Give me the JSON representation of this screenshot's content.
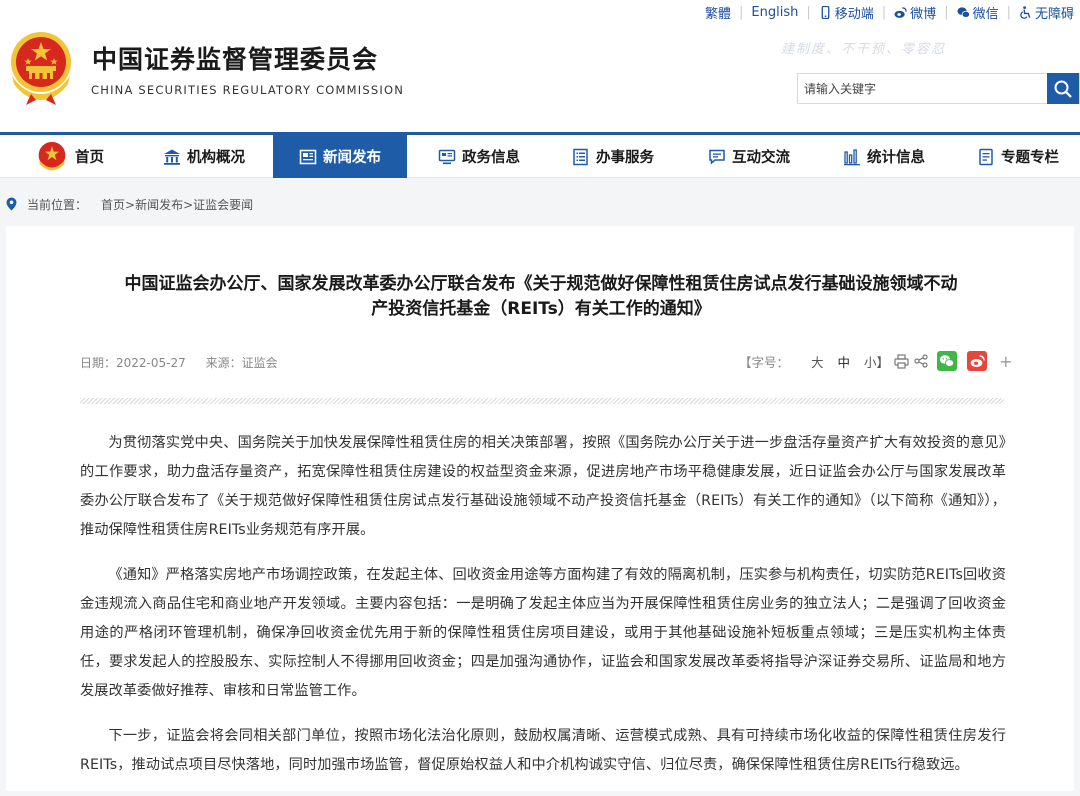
{
  "header": {
    "title_cn": "中国证券监督管理委员会",
    "title_en": "CHINA SECURITIES REGULATORY COMMISSION",
    "slogan": "建制度、不干预、零容忍",
    "top_links": {
      "traditional": "繁體",
      "english": "English",
      "mobile": "移动端",
      "weibo": "微博",
      "wechat": "微信",
      "accessibility": "无障碍"
    },
    "search_placeholder": "请输入关键字"
  },
  "nav": {
    "items": [
      {
        "label": "首页",
        "icon": "emblem-icon"
      },
      {
        "label": "机构概况",
        "icon": "building-icon"
      },
      {
        "label": "新闻发布",
        "icon": "newspaper-icon"
      },
      {
        "label": "政务信息",
        "icon": "monitor-icon"
      },
      {
        "label": "办事服务",
        "icon": "list-icon"
      },
      {
        "label": "互动交流",
        "icon": "chat-icon"
      },
      {
        "label": "统计信息",
        "icon": "bar-chart-icon"
      },
      {
        "label": "专题专栏",
        "icon": "document-icon"
      }
    ],
    "active": "新闻发布"
  },
  "breadcrumb": {
    "prefix": "当前位置：",
    "path": "首页>新闻发布>证监会要闻"
  },
  "article": {
    "title_line1": "中国证监会办公厅、国家发展改革委办公厅联合发布《关于规范做好保障性租赁住房试点发行基础设施领域不动",
    "title_line2": "产投资信托基金（REITs）有关工作的通知》",
    "date": "日期：2022-05-27",
    "source": "来源：证监会",
    "font_size_label": "【字号：",
    "font_large": "大",
    "font_medium": "中",
    "font_small": "小】",
    "plus": "+",
    "paragraphs": [
      "为贯彻落实党中央、国务院关于加快发展保障性租赁住房的相关决策部署，按照《国务院办公厅关于进一步盘活存量资产扩大有效投资的意见》的工作要求，助力盘活存量资产，拓宽保障性租赁住房建设的权益型资金来源，促进房地产市场平稳健康发展，近日证监会办公厅与国家发展改革委办公厅联合发布了《关于规范做好保障性租赁住房试点发行基础设施领域不动产投资信托基金（REITs）有关工作的通知》（以下简称《通知》），推动保障性租赁住房REITs业务规范有序开展。",
      "《通知》严格落实房地产市场调控政策，在发起主体、回收资金用途等方面构建了有效的隔离机制，压实参与机构责任，切实防范REITs回收资金违规流入商品住宅和商业地产开发领域。主要内容包括：一是明确了发起主体应当为开展保障性租赁住房业务的独立法人；二是强调了回收资金用途的严格闭环管理机制，确保净回收资金优先用于新的保障性租赁住房项目建设，或用于其他基础设施补短板重点领域；三是压实机构主体责任，要求发起人的控股股东、实际控制人不得挪用回收资金；四是加强沟通协作，证监会和国家发展改革委将指导沪深证券交易所、证监局和地方发展改革委做好推荐、审核和日常监管工作。",
      "下一步，证监会将会同相关部门单位，按照市场化法治化原则，鼓励权属清晰、运营模式成熟、具有可持续市场化收益的保障性租赁住房发行REITs，推动试点项目尽快落地，同时加强市场监管，督促原始权益人和中介机构诚实守信、归位尽责，确保保障性租赁住房REITs行稳致远。"
    ]
  },
  "colors": {
    "brand_blue": "#1f5ca8",
    "nav_active_bg": "#1f5ca8",
    "wechat_green": "#3fb645",
    "weibo_red": "#e6473c",
    "emblem_red": "#d6281e",
    "emblem_gold": "#f3c437"
  }
}
